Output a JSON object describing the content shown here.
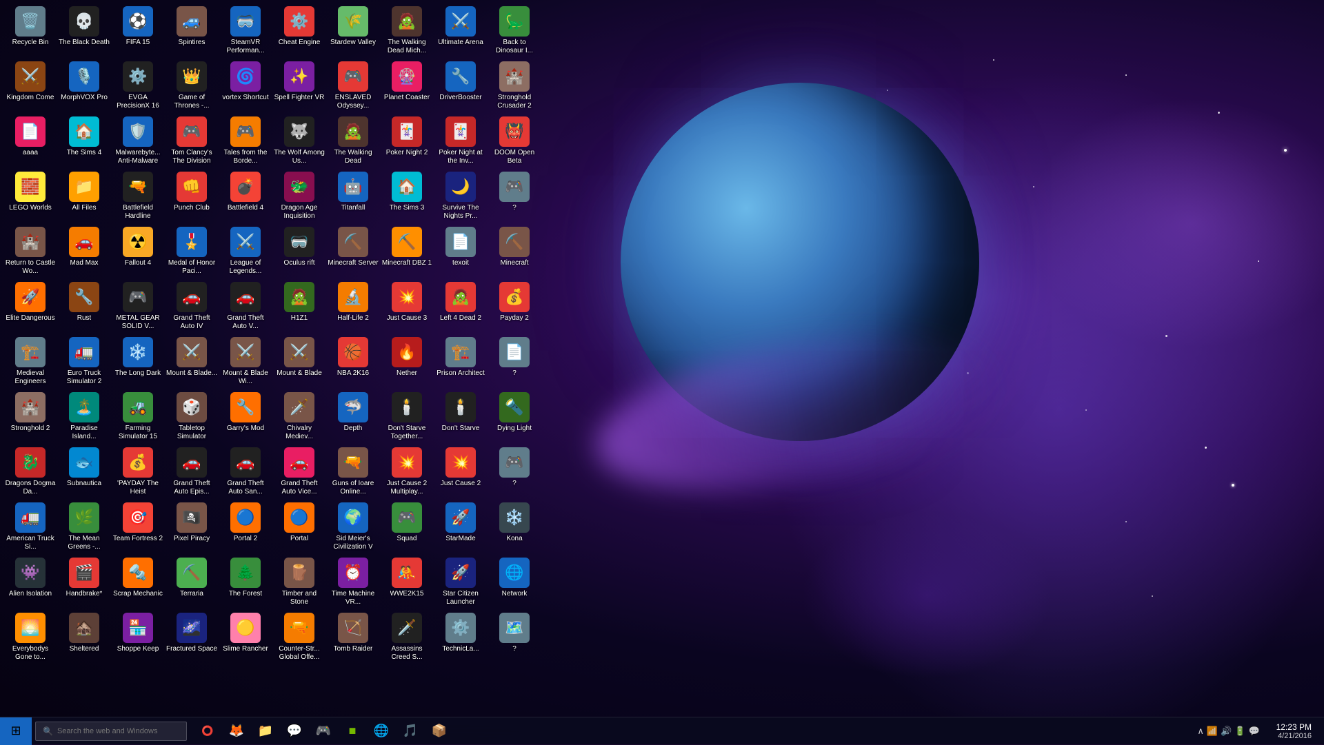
{
  "desktop": {
    "background": "space galaxy with planet",
    "icons": [
      {
        "id": "recycle-bin",
        "label": "Recycle Bin",
        "icon": "🗑️",
        "color": "#607d8b"
      },
      {
        "id": "kingdom-come",
        "label": "Kingdom Come",
        "icon": "⚔️",
        "color": "#8b4513"
      },
      {
        "id": "aaaa",
        "label": "aaaa",
        "icon": "📄",
        "color": "#e91e63"
      },
      {
        "id": "lego-worlds",
        "label": "LEGO Worlds",
        "icon": "🧱",
        "color": "#ffeb3b"
      },
      {
        "id": "return-to-castle",
        "label": "Return to Castle Wo...",
        "icon": "🏰",
        "color": "#795548"
      },
      {
        "id": "elite-dangerous",
        "label": "Elite Dangerous",
        "icon": "🚀",
        "color": "#ff6f00"
      },
      {
        "id": "medieval-engineers",
        "label": "Medieval Engineers",
        "icon": "🏗️",
        "color": "#607d8b"
      },
      {
        "id": "stronghold2",
        "label": "Stronghold 2",
        "icon": "🏰",
        "color": "#8d6e63"
      },
      {
        "id": "dragons-dogma",
        "label": "Dragons Dogma Da...",
        "icon": "🐉",
        "color": "#c62828"
      },
      {
        "id": "american-truck",
        "label": "American Truck Si...",
        "icon": "🚛",
        "color": "#1565c0"
      },
      {
        "id": "alien-isolation",
        "label": "Alien Isolation",
        "icon": "👾",
        "color": "#263238"
      },
      {
        "id": "everybodys-gone",
        "label": "Everybodys Gone to...",
        "icon": "🌅",
        "color": "#ff8f00"
      },
      {
        "id": "black-death",
        "label": "The Black Death",
        "icon": "💀",
        "color": "#212121"
      },
      {
        "id": "morphvox",
        "label": "MorphVOX Pro",
        "icon": "🎙️",
        "color": "#1565c0"
      },
      {
        "id": "sims4",
        "label": "The Sims 4",
        "icon": "🏠",
        "color": "#00bcd4"
      },
      {
        "id": "all-files",
        "label": "All Files",
        "icon": "📁",
        "color": "#ffa000"
      },
      {
        "id": "mad-max",
        "label": "Mad Max",
        "icon": "🚗",
        "color": "#f57c00"
      },
      {
        "id": "rust",
        "label": "Rust",
        "icon": "🔧",
        "color": "#8b4513"
      },
      {
        "id": "euro-truck2",
        "label": "Euro Truck Simulator 2",
        "icon": "🚛",
        "color": "#1565c0"
      },
      {
        "id": "paradise-island",
        "label": "Paradise Island...",
        "icon": "🏝️",
        "color": "#00897b"
      },
      {
        "id": "subnautica",
        "label": "Subnautica",
        "icon": "🐟",
        "color": "#0288d1"
      },
      {
        "id": "mean-greens",
        "label": "The Mean Greens -...",
        "icon": "🌿",
        "color": "#388e3c"
      },
      {
        "id": "handbrake",
        "label": "Handbrake*",
        "icon": "🎬",
        "color": "#e53935"
      },
      {
        "id": "sheltered",
        "label": "Sheltered",
        "icon": "🏚️",
        "color": "#5d4037"
      },
      {
        "id": "fifa15",
        "label": "FIFA 15",
        "icon": "⚽",
        "color": "#1565c0"
      },
      {
        "id": "evga-precision",
        "label": "EVGA PrecisionX 16",
        "icon": "⚙️",
        "color": "#212121"
      },
      {
        "id": "malwarebytes",
        "label": "Malwarebyte... Anti-Malware",
        "icon": "🛡️",
        "color": "#1565c0"
      },
      {
        "id": "battlefield-hardline",
        "label": "Battlefield Hardline",
        "icon": "🔫",
        "color": "#212121"
      },
      {
        "id": "fallout4",
        "label": "Fallout 4",
        "icon": "☢️",
        "color": "#f9a825"
      },
      {
        "id": "metal-gear",
        "label": "METAL GEAR SOLID V...",
        "icon": "🎮",
        "color": "#212121"
      },
      {
        "id": "long-dark",
        "label": "The Long Dark",
        "icon": "❄️",
        "color": "#1565c0"
      },
      {
        "id": "farming-sim15",
        "label": "Farming Simulator 15",
        "icon": "🚜",
        "color": "#388e3c"
      },
      {
        "id": "payday-heist",
        "label": "'PAYDAY The Heist",
        "icon": "💰",
        "color": "#e53935"
      },
      {
        "id": "team-fortress2",
        "label": "Team Fortress 2",
        "icon": "🎯",
        "color": "#f44336"
      },
      {
        "id": "scrap-mechanic",
        "label": "Scrap Mechanic",
        "icon": "🔩",
        "color": "#ff6f00"
      },
      {
        "id": "shoppe-keep",
        "label": "Shoppe Keep",
        "icon": "🏪",
        "color": "#7b1fa2"
      },
      {
        "id": "spintires",
        "label": "Spintires",
        "icon": "🚙",
        "color": "#795548"
      },
      {
        "id": "game-of-thrones",
        "label": "Game of Thrones -...",
        "icon": "👑",
        "color": "#212121"
      },
      {
        "id": "tom-clancy",
        "label": "Tom Clancy's The Division",
        "icon": "🎮",
        "color": "#e53935"
      },
      {
        "id": "punch-club",
        "label": "Punch Club",
        "icon": "👊",
        "color": "#e53935"
      },
      {
        "id": "medal-of-honor",
        "label": "Medal of Honor Paci...",
        "icon": "🎖️",
        "color": "#1565c0"
      },
      {
        "id": "gta4",
        "label": "Grand Theft Auto IV",
        "icon": "🚗",
        "color": "#212121"
      },
      {
        "id": "mount-blade",
        "label": "Mount & Blade...",
        "icon": "⚔️",
        "color": "#795548"
      },
      {
        "id": "tabletop-sim",
        "label": "Tabletop Simulator",
        "icon": "🎲",
        "color": "#6d4c41"
      },
      {
        "id": "gta-epi",
        "label": "Grand Theft Auto Epis...",
        "icon": "🚗",
        "color": "#212121"
      },
      {
        "id": "pixel-piracy",
        "label": "Pixel Piracy",
        "icon": "🏴‍☠️",
        "color": "#795548"
      },
      {
        "id": "terraria",
        "label": "Terraria",
        "icon": "⛏️",
        "color": "#4caf50"
      },
      {
        "id": "fractured-space",
        "label": "Fractured Space",
        "icon": "🌌",
        "color": "#1a237e"
      },
      {
        "id": "steamvr",
        "label": "SteamVR Performan...",
        "icon": "🥽",
        "color": "#1565c0"
      },
      {
        "id": "vortex-shortcut",
        "label": "vortex Shortcut",
        "icon": "🌀",
        "color": "#7b1fa2"
      },
      {
        "id": "tales-borderslands",
        "label": "Tales from the Borde...",
        "icon": "🎮",
        "color": "#f57c00"
      },
      {
        "id": "battlefield4",
        "label": "Battlefield 4",
        "icon": "💣",
        "color": "#f44336"
      },
      {
        "id": "league-legends",
        "label": "League of Legends...",
        "icon": "⚔️",
        "color": "#1565c0"
      },
      {
        "id": "gta5",
        "label": "Grand Theft Auto V...",
        "icon": "🚗",
        "color": "#212121"
      },
      {
        "id": "mount-blade-wi",
        "label": "Mount & Blade Wi...",
        "icon": "⚔️",
        "color": "#795548"
      },
      {
        "id": "garrys-mod",
        "label": "Garry's Mod",
        "icon": "🔧",
        "color": "#ff6f00"
      },
      {
        "id": "gta-san",
        "label": "Grand Theft Auto San...",
        "icon": "🚗",
        "color": "#212121"
      },
      {
        "id": "portal2",
        "label": "Portal 2",
        "icon": "🔵",
        "color": "#ff6f00"
      },
      {
        "id": "forest",
        "label": "The Forest",
        "icon": "🌲",
        "color": "#388e3c"
      },
      {
        "id": "slime-rancher",
        "label": "Slime Rancher",
        "icon": "🟡",
        "color": "#ff80ab"
      },
      {
        "id": "cheat-engine",
        "label": "Cheat Engine",
        "icon": "⚙️",
        "color": "#e53935"
      },
      {
        "id": "spell-fighter",
        "label": "Spell Fighter VR",
        "icon": "✨",
        "color": "#7b1fa2"
      },
      {
        "id": "wolf-among-us",
        "label": "The Wolf Among Us...",
        "icon": "🐺",
        "color": "#212121"
      },
      {
        "id": "dragon-age",
        "label": "Dragon Age Inquisition",
        "icon": "🐲",
        "color": "#880e4f"
      },
      {
        "id": "oculus-rift",
        "label": "Oculus rift",
        "icon": "🥽",
        "color": "#212121"
      },
      {
        "id": "h1z1",
        "label": "H1Z1",
        "icon": "🧟",
        "color": "#33691e"
      },
      {
        "id": "mount-blade2",
        "label": "Mount & Blade",
        "icon": "⚔️",
        "color": "#795548"
      },
      {
        "id": "chivalry",
        "label": "Chivalry Mediev...",
        "icon": "🗡️",
        "color": "#795548"
      },
      {
        "id": "gta-vice",
        "label": "Grand Theft Auto Vice...",
        "icon": "🚗",
        "color": "#e91e63"
      },
      {
        "id": "portal-normal",
        "label": "Portal",
        "icon": "🔵",
        "color": "#ff6f00"
      },
      {
        "id": "timber-stone",
        "label": "Timber and Stone",
        "icon": "🪵",
        "color": "#795548"
      },
      {
        "id": "counter-strike",
        "label": "Counter-Str... Global Offe...",
        "icon": "🔫",
        "color": "#f57c00"
      },
      {
        "id": "stardew-valley",
        "label": "Stardew Valley",
        "icon": "🌾",
        "color": "#66bb6a"
      },
      {
        "id": "enslaved",
        "label": "ENSLAVED Odyssey...",
        "icon": "🎮",
        "color": "#e53935"
      },
      {
        "id": "walking-dead",
        "label": "The Walking Dead",
        "icon": "🧟",
        "color": "#4e342e"
      },
      {
        "id": "titanfall",
        "label": "Titanfall",
        "icon": "🤖",
        "color": "#1565c0"
      },
      {
        "id": "minecraft-server",
        "label": "Minecraft Server",
        "icon": "⛏️",
        "color": "#795548"
      },
      {
        "id": "half-life2",
        "label": "Half-Life 2",
        "icon": "🔬",
        "color": "#f57c00"
      },
      {
        "id": "nba2k16",
        "label": "NBA 2K16",
        "icon": "🏀",
        "color": "#e53935"
      },
      {
        "id": "depth",
        "label": "Depth",
        "icon": "🦈",
        "color": "#1565c0"
      },
      {
        "id": "guns-online",
        "label": "Guns of Ioare Online...",
        "icon": "🔫",
        "color": "#795548"
      },
      {
        "id": "civ5",
        "label": "Sid Meier's Civilization V",
        "icon": "🌍",
        "color": "#1565c0"
      },
      {
        "id": "time-machine",
        "label": "Time Machine VR...",
        "icon": "⏰",
        "color": "#7b1fa2"
      },
      {
        "id": "tomb-raider",
        "label": "Tomb Raider",
        "icon": "🏹",
        "color": "#795548"
      },
      {
        "id": "walking-dead-mich",
        "label": "The Walking Dead Mich...",
        "icon": "🧟",
        "color": "#4e342e"
      },
      {
        "id": "planet-coaster",
        "label": "Planet Coaster",
        "icon": "🎡",
        "color": "#e91e63"
      },
      {
        "id": "poker-night2",
        "label": "Poker Night 2",
        "icon": "🃏",
        "color": "#c62828"
      },
      {
        "id": "sims3",
        "label": "The Sims 3",
        "icon": "🏠",
        "color": "#00bcd4"
      },
      {
        "id": "minecraft-dbz",
        "label": "Minecraft DBZ 1",
        "icon": "⛏️",
        "color": "#ff8f00"
      },
      {
        "id": "just-cause3",
        "label": "Just Cause 3",
        "icon": "💥",
        "color": "#e53935"
      },
      {
        "id": "nether",
        "label": "Nether",
        "icon": "🔥",
        "color": "#b71c1c"
      },
      {
        "id": "dont-starve-tog",
        "label": "Don't Starve Together...",
        "icon": "🕯️",
        "color": "#212121"
      },
      {
        "id": "just-cause2-multi",
        "label": "Just Cause 2 Multiplay...",
        "icon": "💥",
        "color": "#e53935"
      },
      {
        "id": "squad",
        "label": "Squad",
        "icon": "🎮",
        "color": "#388e3c"
      },
      {
        "id": "wwe2k15",
        "label": "WWE2K15",
        "icon": "🤼",
        "color": "#e53935"
      },
      {
        "id": "assassins-creed",
        "label": "Assassins Creed S...",
        "icon": "🗡️",
        "color": "#212121"
      },
      {
        "id": "ultimate-arena",
        "label": "Ultimate Arena",
        "icon": "⚔️",
        "color": "#1565c0"
      },
      {
        "id": "driverbooster",
        "label": "DriverBooster",
        "icon": "🔧",
        "color": "#1565c0"
      },
      {
        "id": "poker-night-inv",
        "label": "Poker Night at the Inv...",
        "icon": "🃏",
        "color": "#c62828"
      },
      {
        "id": "survive-nights",
        "label": "Survive The Nights Pr...",
        "icon": "🌙",
        "color": "#1a237e"
      },
      {
        "id": "texoit",
        "label": "texoit",
        "icon": "📄",
        "color": "#607d8b"
      },
      {
        "id": "left4dead2",
        "label": "Left 4 Dead 2",
        "icon": "🧟",
        "color": "#e53935"
      },
      {
        "id": "prison-architect",
        "label": "Prison Architect",
        "icon": "🏗️",
        "color": "#607d8b"
      },
      {
        "id": "dont-starve",
        "label": "Don't Starve",
        "icon": "🕯️",
        "color": "#212121"
      },
      {
        "id": "just-cause2",
        "label": "Just Cause 2",
        "icon": "💥",
        "color": "#e53935"
      },
      {
        "id": "starmade",
        "label": "StarMade",
        "icon": "🚀",
        "color": "#1565c0"
      },
      {
        "id": "star-citizen",
        "label": "Star Citizen Launcher",
        "icon": "🚀",
        "color": "#1a237e"
      },
      {
        "id": "technic-launcher",
        "label": "TechnicLa...",
        "icon": "⚙️",
        "color": "#607d8b"
      },
      {
        "id": "back-to-dinosaur",
        "label": "Back to Dinosaur I...",
        "icon": "🦕",
        "color": "#388e3c"
      },
      {
        "id": "stronghold-crusader",
        "label": "Stronghold Crusader 2",
        "icon": "🏰",
        "color": "#8d6e63"
      },
      {
        "id": "doom-open-beta",
        "label": "DOOM Open Beta",
        "icon": "👹",
        "color": "#e53935"
      },
      {
        "id": "row4",
        "label": "?",
        "icon": "🎮",
        "color": "#607d8b"
      },
      {
        "id": "minecraft3",
        "label": "Minecraft",
        "icon": "⛏️",
        "color": "#795548"
      },
      {
        "id": "payday2",
        "label": "Payday 2",
        "icon": "💰",
        "color": "#e53935"
      },
      {
        "id": "row4b",
        "label": "?",
        "icon": "📄",
        "color": "#607d8b"
      },
      {
        "id": "dead-light",
        "label": "Dying Light",
        "icon": "🔦",
        "color": "#33691e"
      },
      {
        "id": "row4c",
        "label": "?",
        "icon": "🎮",
        "color": "#607d8b"
      },
      {
        "id": "kona",
        "label": "Kona",
        "icon": "❄️",
        "color": "#37474f"
      },
      {
        "id": "network",
        "label": "Network",
        "icon": "🌐",
        "color": "#1565c0"
      },
      {
        "id": "row4d",
        "label": "?",
        "icon": "🗺️",
        "color": "#607d8b"
      }
    ]
  },
  "taskbar": {
    "start_label": "⊞",
    "search_placeholder": "Search the web and Windows",
    "clock": {
      "time": "12:23 PM",
      "date": "4/21/2016"
    },
    "apps": [
      {
        "id": "firefox",
        "icon": "🦊"
      },
      {
        "id": "file-explorer",
        "icon": "📁"
      },
      {
        "id": "skype",
        "icon": "💬"
      },
      {
        "id": "steam",
        "icon": "🎮"
      },
      {
        "id": "nvidia",
        "icon": "🟢"
      },
      {
        "id": "ie",
        "icon": "🌐"
      },
      {
        "id": "media",
        "icon": "🎵"
      },
      {
        "id": "vmware",
        "icon": "📦"
      }
    ]
  }
}
